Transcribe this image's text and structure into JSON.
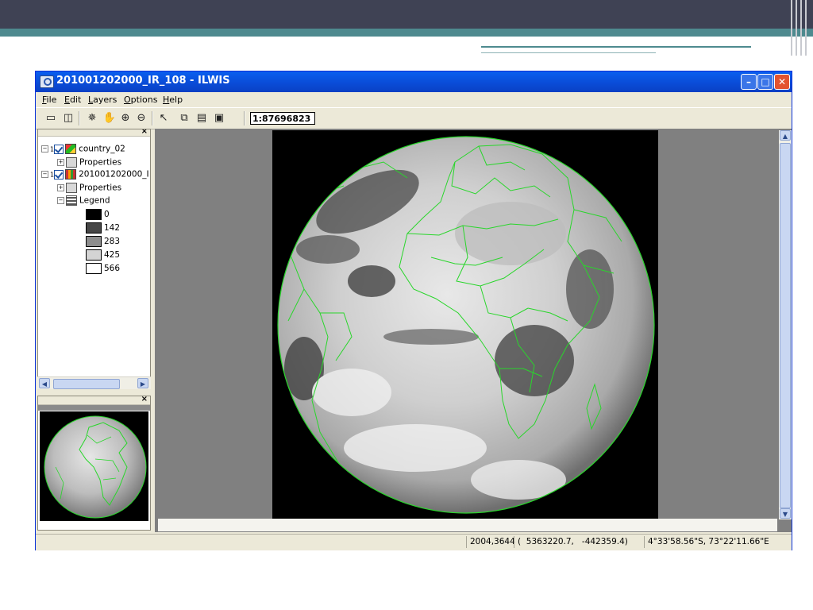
{
  "window": {
    "title": "201001202000_IR_108 - ILWIS",
    "minimize_glyph": "–",
    "maximize_glyph": "□",
    "close_glyph": "✕"
  },
  "menu": [
    "File",
    "Edit",
    "Layers",
    "Options",
    "Help"
  ],
  "toolbar": {
    "scale": "1:87696823",
    "icons": [
      "new-map-icon",
      "display-icon",
      "normal-pointer-icon",
      "pan-hand-icon",
      "zoom-in-icon",
      "zoom-out-icon",
      "select-arrow-icon",
      "copy-icon",
      "print-icon",
      "save-icon"
    ]
  },
  "layers": {
    "close_glyph": "×",
    "items": [
      {
        "label": "country_02",
        "expander": "−",
        "index": "1"
      },
      {
        "label": "Properties",
        "expander": "+"
      },
      {
        "label": "201001202000_I",
        "expander": "−",
        "index": "1"
      },
      {
        "label": "Properties",
        "expander": "+"
      },
      {
        "label": "Legend",
        "expander": "−"
      }
    ],
    "legend": [
      {
        "value": "0",
        "color": "#000000"
      },
      {
        "value": "142",
        "color": "#464646"
      },
      {
        "value": "283",
        "color": "#8d8d8d"
      },
      {
        "value": "425",
        "color": "#d4d4d4"
      },
      {
        "value": "566",
        "color": "#ffffff"
      }
    ]
  },
  "overview": {
    "close_glyph": "×"
  },
  "scrollbars": {
    "left_arrow": "◀",
    "right_arrow": "▶",
    "up_arrow": "▲",
    "down_arrow": "▼"
  },
  "status": {
    "rowcol": "2004,3644",
    "xy": "(  5363220.7,   -442359.4)",
    "latlon": "4°33'58.56\"S, 73°22'11.66\"E"
  },
  "colors": {
    "boundary": "#29d62b",
    "titlebar": "#0a5fef",
    "slide_header": "#3f4254",
    "slide_accent": "#4e8a8f"
  }
}
